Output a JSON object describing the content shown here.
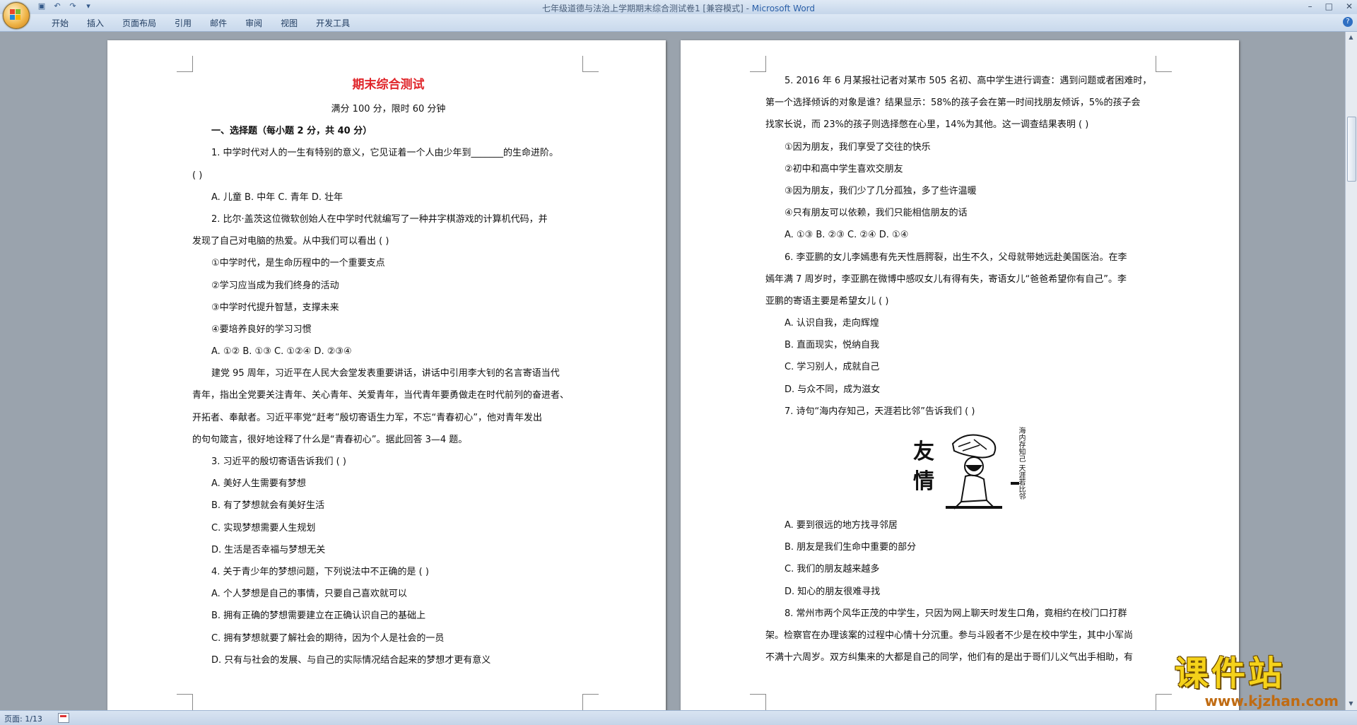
{
  "window": {
    "title": "七年级道德与法治上学期期末综合测试卷1 [兼容模式] - ",
    "app_name": "Microsoft Word"
  },
  "ribbon": {
    "tabs": [
      "开始",
      "插入",
      "页面布局",
      "引用",
      "邮件",
      "审阅",
      "视图",
      "开发工具"
    ]
  },
  "statusbar": {
    "page": "页面: 1/13"
  },
  "page1": {
    "title": "期末综合测试",
    "subtitle": "满分 100 分，限时 60 分钟",
    "section": "一、选择题（每小题 2 分，共 40 分）",
    "lines": [
      {
        "text": "1. 中学时代对人的一生有特别的意义，它见证着一个人由少年到_______的生命进阶。",
        "indent": true
      },
      {
        "text": "(      )",
        "indent": false
      },
      {
        "text": "A. 儿童      B. 中年      C. 青年      D. 壮年",
        "indent": true
      },
      {
        "text": "2. 比尔·盖茨这位微软创始人在中学时代就编写了一种井字棋游戏的计算机代码，并",
        "indent": true
      },
      {
        "text": "发现了自己对电脑的热爱。从中我们可以看出      (      )",
        "indent": false
      },
      {
        "text": "①中学时代，是生命历程中的一个重要支点",
        "indent": true
      },
      {
        "text": "②学习应当成为我们终身的活动",
        "indent": true
      },
      {
        "text": "③中学时代提升智慧，支撑未来",
        "indent": true
      },
      {
        "text": "④要培养良好的学习习惯",
        "indent": true
      },
      {
        "text": "A. ①②      B. ①③      C. ①②④      D. ②③④",
        "indent": true
      },
      {
        "text": "建党 95 周年，习近平在人民大会堂发表重要讲话，讲话中引用李大钊的名言寄语当代",
        "indent": true
      },
      {
        "text": "青年，指出全党要关注青年、关心青年、关爱青年，当代青年要勇做走在时代前列的奋进者、",
        "indent": false
      },
      {
        "text": "开拓者、奉献者。习近平率党“赶考”殷切寄语生力军，不忘“青春初心”，他对青年发出",
        "indent": false
      },
      {
        "text": "的句句箴言，很好地诠释了什么是“青春初心”。据此回答 3—4 题。",
        "indent": false
      },
      {
        "text": "3. 习近平的殷切寄语告诉我们      (      )",
        "indent": true
      },
      {
        "text": "A. 美好人生需要有梦想",
        "indent": true
      },
      {
        "text": "B. 有了梦想就会有美好生活",
        "indent": true
      },
      {
        "text": "C. 实现梦想需要人生规划",
        "indent": true
      },
      {
        "text": "D. 生活是否幸福与梦想无关",
        "indent": true
      },
      {
        "text": "4. 关于青少年的梦想问题，下列说法中不正确的是      (      )",
        "indent": true
      },
      {
        "text": "A. 个人梦想是自己的事情，只要自己喜欢就可以",
        "indent": true
      },
      {
        "text": "B. 拥有正确的梦想需要建立在正确认识自己的基础上",
        "indent": true
      },
      {
        "text": "C. 拥有梦想就要了解社会的期待，因为个人是社会的一员",
        "indent": true
      },
      {
        "text": "D. 只有与社会的发展、与自己的实际情况结合起来的梦想才更有意义",
        "indent": true
      }
    ]
  },
  "page2": {
    "lines_a": [
      {
        "text": "5. 2016 年 6 月某报社记者对某市 505 名初、高中学生进行调查：遇到问题或者困难时，",
        "indent": true
      },
      {
        "text": "第一个选择倾诉的对象是谁？结果显示：58%的孩子会在第一时间找朋友倾诉，5%的孩子会",
        "indent": false
      },
      {
        "text": "找家长说，而 23%的孩子则选择憋在心里，14%为其他。这一调查结果表明      (      )",
        "indent": false
      },
      {
        "text": "①因为朋友，我们享受了交往的快乐",
        "indent": true
      },
      {
        "text": "②初中和高中学生喜欢交朋友",
        "indent": true
      },
      {
        "text": "③因为朋友，我们少了几分孤独，多了些许温暖",
        "indent": true
      },
      {
        "text": "④只有朋友可以依赖，我们只能相信朋友的话",
        "indent": true
      },
      {
        "text": "A. ①③      B. ②③      C. ②④      D. ①④",
        "indent": true
      },
      {
        "text": "6. 李亚鹏的女儿李嫣患有先天性唇腭裂，出生不久，父母就带她远赴美国医治。在李",
        "indent": true
      },
      {
        "text": "嫣年满 7 周岁时，李亚鹏在微博中感叹女儿有得有失，寄语女儿“爸爸希望你有自己”。李",
        "indent": false
      },
      {
        "text": "亚鹏的寄语主要是希望女儿      (      )",
        "indent": false
      },
      {
        "text": "A. 认识自我，走向辉煌",
        "indent": true
      },
      {
        "text": "B. 直面现实，悦纳自我",
        "indent": true
      },
      {
        "text": "C. 学习别人，成就自己",
        "indent": true
      },
      {
        "text": "D. 与众不同，成为滋女",
        "indent": true
      },
      {
        "text": "7. 诗句“海内存知己，天涯若比邻”告诉我们      (      )",
        "indent": true
      }
    ],
    "figure": {
      "char1": "友",
      "char2": "情",
      "poem": "海内存知己 天涯若比邻"
    },
    "lines_b": [
      {
        "text": "A. 要到很远的地方找寻邻居",
        "indent": true
      },
      {
        "text": "B. 朋友是我们生命中重要的部分",
        "indent": true
      },
      {
        "text": "C. 我们的朋友越来越多",
        "indent": true
      },
      {
        "text": "D. 知心的朋友很难寻找",
        "indent": true
      },
      {
        "text": "8. 常州市两个风华正茂的中学生，只因为网上聊天时发生口角，竟相约在校门口打群",
        "indent": true
      },
      {
        "text": "架。检察官在办理该案的过程中心情十分沉重。参与斗殴者不少是在校中学生，其中小军尚",
        "indent": false
      },
      {
        "text": "不满十六周岁。双方纠集来的大都是自己的同学，他们有的是出于哥们儿义气出手相助，有",
        "indent": false
      }
    ]
  },
  "watermark": {
    "title": "课件站",
    "url": "www.kjzhan.com"
  }
}
